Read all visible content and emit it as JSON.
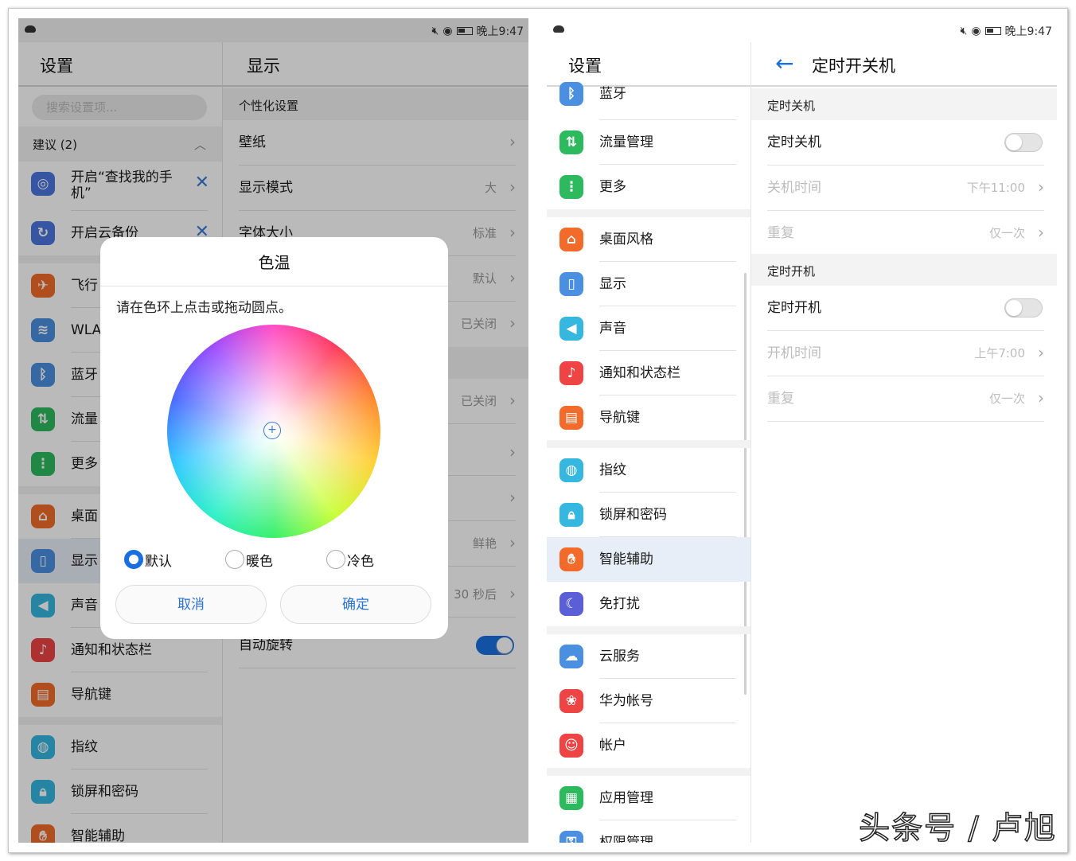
{
  "statusbar": {
    "time": "晚上9:47"
  },
  "left_screen": {
    "settings_title": "设置",
    "search_placeholder": "搜索设置项...",
    "suggest_header": "建议 (2)",
    "suggestions": [
      {
        "label": "开启“查找我的手机”"
      },
      {
        "label": "开启云备份"
      }
    ],
    "menu": [
      {
        "label": "飞行"
      },
      {
        "label": "WLA"
      },
      {
        "label": "蓝牙"
      },
      {
        "label": "流量"
      },
      {
        "label": "更多"
      },
      {
        "label": "桌面"
      },
      {
        "label": "显示"
      },
      {
        "label": "声音"
      },
      {
        "label": "通知和状态栏"
      },
      {
        "label": "导航键"
      },
      {
        "label": "指纹"
      },
      {
        "label": "锁屏和密码"
      },
      {
        "label": "智能辅助"
      }
    ],
    "display_title": "显示",
    "personal_header": "个性化设置",
    "display_rows": [
      {
        "label": "壁纸",
        "value": ""
      },
      {
        "label": "显示模式",
        "value": "大"
      },
      {
        "label": "字体大小",
        "value": "标准"
      },
      {
        "label": "",
        "value": "默认"
      },
      {
        "label": "",
        "value": "已关闭"
      },
      {
        "label": "",
        "value": "已关闭"
      },
      {
        "label": "",
        "value": ""
      },
      {
        "label": "",
        "value": ""
      },
      {
        "label": "",
        "value": "鲜艳"
      },
      {
        "label": "",
        "value": "30 秒后"
      },
      {
        "label": "自动旋转",
        "value": ""
      }
    ],
    "auto_rotate_on": true,
    "dialog": {
      "title": "色温",
      "hint": "请在色环上点击或拖动圆点。",
      "options": [
        "默认",
        "暖色",
        "冷色"
      ],
      "selected": "默认",
      "cancel": "取消",
      "confirm": "确定"
    }
  },
  "right_screen": {
    "settings_title": "设置",
    "menu": [
      {
        "label": "蓝牙"
      },
      {
        "label": "流量管理"
      },
      {
        "label": "更多"
      },
      {
        "label": "桌面风格"
      },
      {
        "label": "显示"
      },
      {
        "label": "声音"
      },
      {
        "label": "通知和状态栏"
      },
      {
        "label": "导航键"
      },
      {
        "label": "指纹"
      },
      {
        "label": "锁屏和密码"
      },
      {
        "label": "智能辅助"
      },
      {
        "label": "免打扰"
      },
      {
        "label": "云服务"
      },
      {
        "label": "华为帐号"
      },
      {
        "label": "帐户"
      },
      {
        "label": "应用管理"
      },
      {
        "label": "权限管理"
      }
    ],
    "selected_item": "智能辅助",
    "detail_title": "定时开关机",
    "off_header": "定时关机",
    "off_toggle_label": "定时关机",
    "off_time_label": "关机时间",
    "off_time_value": "下午11:00",
    "off_repeat_label": "重复",
    "off_repeat_value": "仅一次",
    "on_header": "定时开机",
    "on_toggle_label": "定时开机",
    "on_time_label": "开机时间",
    "on_time_value": "上午7:00",
    "on_repeat_label": "重复",
    "on_repeat_value": "仅一次"
  },
  "watermark": "头条号 / 卢旭",
  "colors": {
    "accent": "#1a6fe0",
    "orange": "#f26b2a",
    "blue": "#4a8fe0",
    "green": "#2dba5e",
    "red": "#ee4444",
    "cyan": "#35b7e0"
  },
  "icons": [
    "bluetooth-icon",
    "data-icon",
    "more-icon",
    "home-icon",
    "display-icon",
    "sound-icon",
    "bell-icon",
    "nav-icon",
    "fingerprint-icon",
    "lock-icon",
    "hand-icon",
    "moon-icon",
    "cloud-icon",
    "huawei-icon",
    "account-icon",
    "apps-icon",
    "permission-icon"
  ]
}
